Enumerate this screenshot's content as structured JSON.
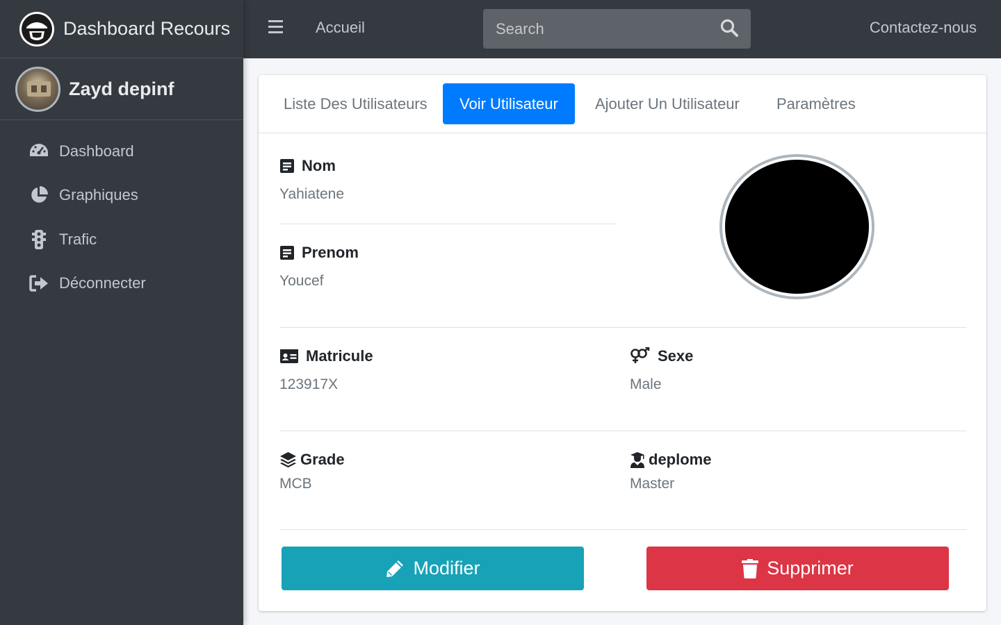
{
  "brand": {
    "title": "Dashboard Recours",
    "logo_icon": "helmet-logo-icon"
  },
  "user": {
    "name": "Zayd depinf"
  },
  "sidebar": {
    "items": [
      {
        "label": "Dashboard",
        "icon": "tachometer-icon"
      },
      {
        "label": "Graphiques",
        "icon": "pie-chart-icon"
      },
      {
        "label": "Trafic",
        "icon": "traffic-light-icon"
      },
      {
        "label": "Déconnecter",
        "icon": "sign-out-icon"
      }
    ]
  },
  "header": {
    "home_label": "Accueil",
    "search_placeholder": "Search",
    "contact_label": "Contactez-nous"
  },
  "tabs": [
    {
      "label": "Liste Des Utilisateurs",
      "active": false
    },
    {
      "label": "Voir Utilisateur",
      "active": true
    },
    {
      "label": "Ajouter Un Utilisateur",
      "active": false
    },
    {
      "label": "Paramètres",
      "active": false
    }
  ],
  "profile": {
    "nom": {
      "label": "Nom",
      "value": "Yahiatene"
    },
    "prenom": {
      "label": "Prenom",
      "value": "Youcef"
    },
    "matricule": {
      "label": "Matricule",
      "value": "123917X"
    },
    "sexe": {
      "label": "Sexe",
      "value": "Male"
    },
    "grade": {
      "label": "Grade",
      "value": "MCB"
    },
    "deplome": {
      "label": "deplome",
      "value": "Master"
    }
  },
  "actions": {
    "edit_label": "Modifier",
    "delete_label": "Supprimer"
  },
  "colors": {
    "sidebar_bg": "#343a40",
    "primary": "#007bff",
    "info": "#17a2b8",
    "danger": "#dc3545"
  }
}
